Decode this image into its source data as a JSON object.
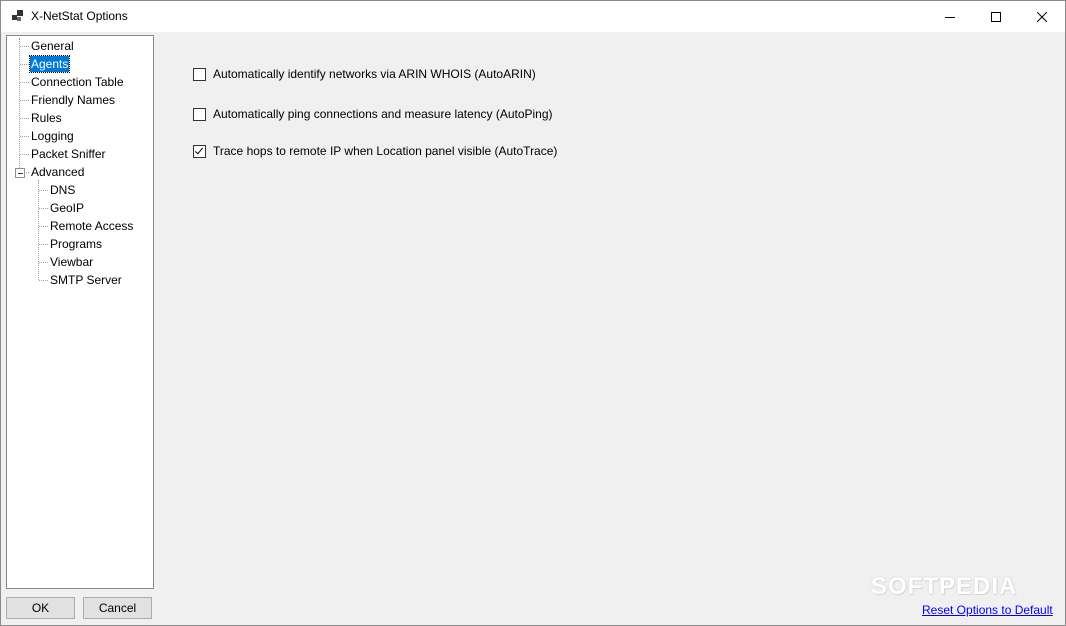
{
  "window": {
    "title": "X-NetStat Options"
  },
  "tree": {
    "items": [
      {
        "label": "General"
      },
      {
        "label": "Agents",
        "selected": true
      },
      {
        "label": "Connection Table"
      },
      {
        "label": "Friendly Names"
      },
      {
        "label": "Rules"
      },
      {
        "label": "Logging"
      },
      {
        "label": "Packet Sniffer"
      },
      {
        "label": "Advanced",
        "expanded": true
      }
    ],
    "advanced_children": [
      {
        "label": "DNS"
      },
      {
        "label": "GeoIP"
      },
      {
        "label": "Remote Access"
      },
      {
        "label": "Programs"
      },
      {
        "label": "Viewbar"
      },
      {
        "label": "SMTP Server"
      }
    ]
  },
  "options": [
    {
      "label": "Automatically identify networks via ARIN WHOIS (AutoARIN)",
      "checked": false
    },
    {
      "label": "Automatically ping connections and measure latency (AutoPing)",
      "checked": false
    },
    {
      "label": "Trace hops to remote IP when Location panel visible (AutoTrace)",
      "checked": true
    }
  ],
  "buttons": {
    "ok": "OK",
    "cancel": "Cancel"
  },
  "reset_link": "Reset Options to Default",
  "watermark": "SOFTPEDIA",
  "colors": {
    "selection": "#0078d7",
    "link": "#0000ff",
    "panel_bg": "#f0f0f0"
  }
}
